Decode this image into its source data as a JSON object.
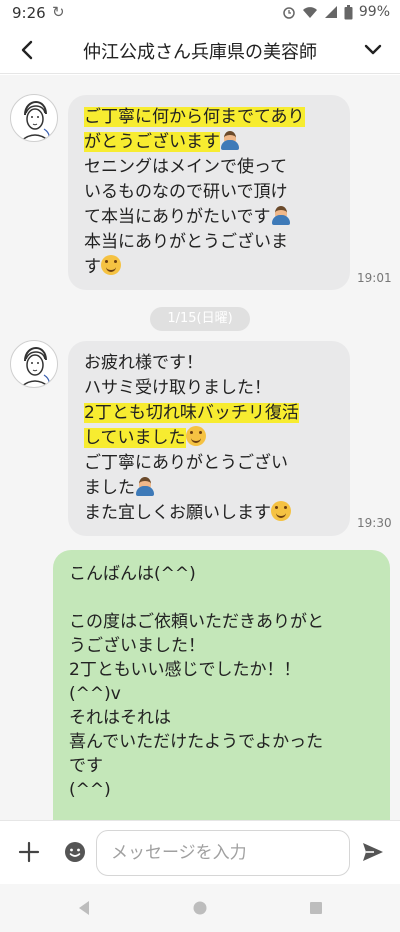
{
  "status_bar": {
    "time": "9:26",
    "battery": "99%"
  },
  "header": {
    "title": "仲江公成さん兵庫県の美容師"
  },
  "messages": [
    {
      "direction": "incoming",
      "lines": [
        {
          "text": "ご丁寧に何から何までてあり",
          "highlight": true
        },
        {
          "text": "がとうございます",
          "highlight": true,
          "emoji": "person-bowing"
        },
        {
          "text": "セニングはメインで使って"
        },
        {
          "text": "いるものなので研いで頂け"
        },
        {
          "text": "て本当にありがたいです",
          "emoji": "person-bowing"
        },
        {
          "text": "本当にありがとうございま"
        },
        {
          "text": "す",
          "emoji": "smiling-face"
        }
      ],
      "time": "19:01"
    },
    {
      "direction": "incoming",
      "lines": [
        {
          "text": "お疲れ様です！"
        },
        {
          "text": "ハサミ受け取りました！"
        },
        {
          "text": "2丁とも切れ味バッチリ復活",
          "highlight": true
        },
        {
          "text": "していました",
          "highlight": true,
          "emoji": "smiling-face"
        },
        {
          "text": "ご丁寧にありがとうござい"
        },
        {
          "text": "ました",
          "emoji": "person-bowing"
        },
        {
          "text": "また宜しくお願いします",
          "emoji": "smiling-face"
        }
      ],
      "time": "19:30"
    },
    {
      "direction": "outgoing",
      "lines": [
        {
          "text": "こんばんは(^^)"
        },
        {
          "text": ""
        },
        {
          "text": "この度はご依頼いただきありがと"
        },
        {
          "text": "うございました！"
        },
        {
          "text": "2丁ともいい感じでしたか！！"
        },
        {
          "text": "(^^)v"
        },
        {
          "text": "それはそれは"
        },
        {
          "text": "喜んでいただけたようでよかった"
        },
        {
          "text": "です"
        },
        {
          "text": "(^^)"
        }
      ]
    }
  ],
  "date_separator": "1/15(日曜)",
  "input": {
    "placeholder": "メッセージを入力"
  },
  "colors": {
    "incoming_bubble": "#e9e9ea",
    "outgoing_bubble": "#c4e7b9",
    "highlight": "#f7ec30",
    "chat_background": "#f5f5f5"
  }
}
